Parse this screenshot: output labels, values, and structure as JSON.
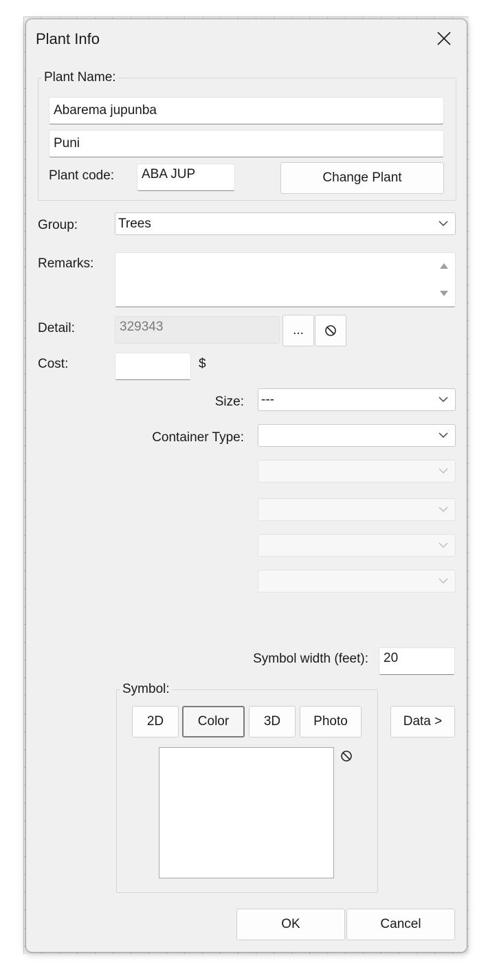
{
  "dialog": {
    "title": "Plant Info",
    "close_icon": "close-x-icon"
  },
  "plant_name": {
    "legend": "Plant Name:",
    "scientific_name": "Abarema jupunba",
    "common_name": "Puni",
    "code_label": "Plant code:",
    "code_value": "ABA JUP",
    "change_button": "Change Plant"
  },
  "group": {
    "label": "Group:",
    "value": "Trees"
  },
  "remarks": {
    "label": "Remarks:",
    "value": ""
  },
  "detail": {
    "label": "Detail:",
    "value": "329343",
    "browse_button": "...",
    "clear_icon": "prohibited-icon"
  },
  "cost": {
    "label": "Cost:",
    "value": "",
    "unit": "$"
  },
  "size": {
    "label": "Size:",
    "value": "---"
  },
  "container_type": {
    "label": "Container Type:",
    "value": ""
  },
  "extra_combos": [
    "",
    "",
    "",
    ""
  ],
  "symbol_width": {
    "label": "Symbol width (feet):",
    "value": "20"
  },
  "symbol": {
    "legend": "Symbol:",
    "tabs": [
      {
        "label": "2D",
        "active": false
      },
      {
        "label": "Color",
        "active": true
      },
      {
        "label": "3D",
        "active": false
      },
      {
        "label": "Photo",
        "active": false
      }
    ],
    "clear_icon": "prohibited-icon"
  },
  "data_button": "Data >",
  "footer": {
    "ok": "OK",
    "cancel": "Cancel"
  },
  "colors": {
    "dialog_bg": "#f0f0f0",
    "input_bg": "#ffffff",
    "disabled_text": "#7a7a7a"
  }
}
